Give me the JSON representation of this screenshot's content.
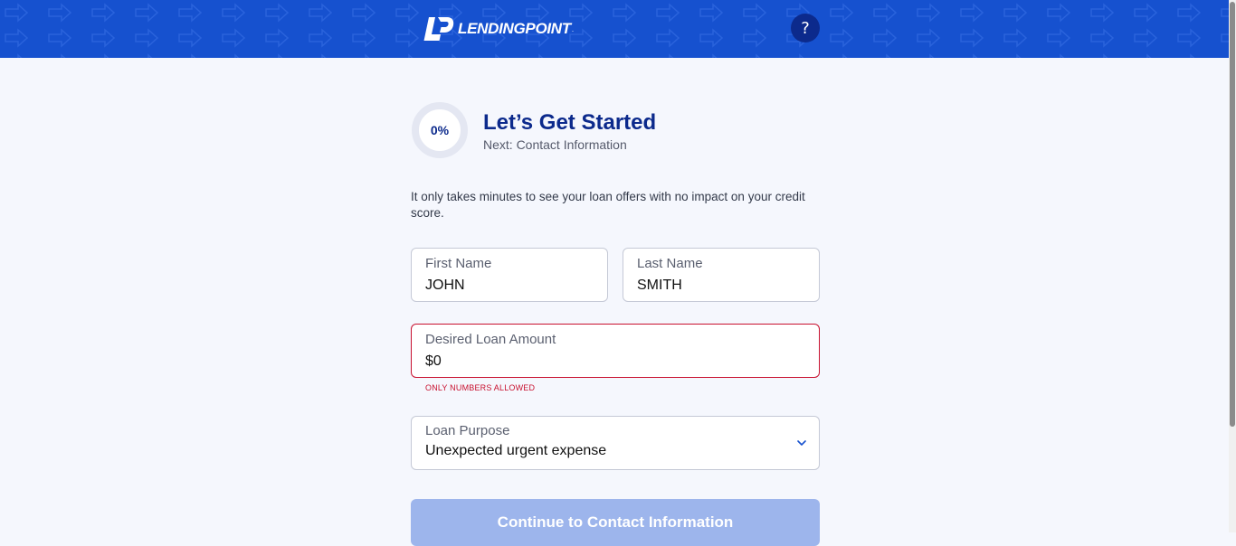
{
  "header": {
    "brand": "LENDINGPOINT",
    "brand_mark": ".",
    "help_label": "?"
  },
  "progress": {
    "value_label": "0%",
    "value": 0
  },
  "page": {
    "title": "Let’s Get Started",
    "subtitle": "Next: Contact Information",
    "intro": "It only takes minutes to see your loan offers with no impact on your credit score."
  },
  "form": {
    "first_name": {
      "label": "First Name",
      "value": "JOHN"
    },
    "last_name": {
      "label": "Last Name",
      "value": "SMITH"
    },
    "loan_amount": {
      "label": "Desired Loan Amount",
      "value": "$0",
      "error": "ONLY NUMBERS ALLOWED"
    },
    "loan_purpose": {
      "label": "Loan Purpose",
      "value": "Unexpected urgent expense"
    },
    "continue_label": "Continue to Contact Information"
  },
  "colors": {
    "header_bg": "#1651cf",
    "brand_dark": "#0c2a8c",
    "error": "#c8102e",
    "button_disabled": "#9db5ec"
  },
  "icons": {
    "logo": "lendingpoint-logo-icon",
    "help": "question-mark-icon",
    "select": "chevron-down-icon"
  }
}
